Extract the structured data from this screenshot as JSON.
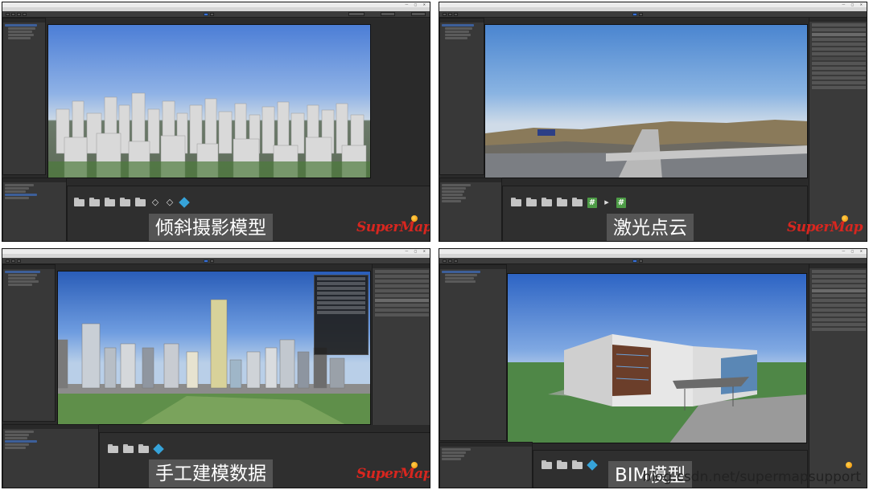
{
  "panels": [
    {
      "caption": "倾斜摄影模型"
    },
    {
      "caption": "激光点云"
    },
    {
      "caption": "手工建模数据"
    },
    {
      "caption": "BIM模型"
    }
  ],
  "logo_text": "SuperMap",
  "watermark": "blog.csdn.net/supermapsupport",
  "colors": {
    "logo": "#d8261f",
    "editor_bg": "#2a2a2a",
    "play_button": "#3a6fd8",
    "caption_bg": "#5a5a5a"
  }
}
